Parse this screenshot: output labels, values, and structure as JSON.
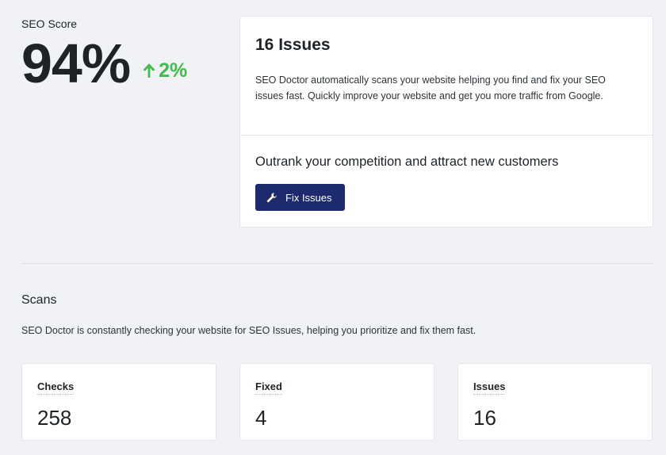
{
  "score": {
    "label": "SEO Score",
    "value": "94%",
    "change": "2%",
    "change_color": "#3ebd4a",
    "change_icon": "arrow-up-icon"
  },
  "issues_card": {
    "title": "16 Issues",
    "description": "SEO Doctor automatically scans your website helping you find and fix your SEO issues fast. Quickly improve your website and get you more traffic from Google.",
    "cta_heading": "Outrank your competition and attract new customers",
    "button_label": "Fix Issues",
    "button_icon": "wrench-icon",
    "button_color": "#1e2a6e"
  },
  "scans": {
    "title": "Scans",
    "description": "SEO Doctor is constantly checking your website for SEO Issues, helping you prioritize and fix them fast.",
    "stats": [
      {
        "label": "Checks",
        "value": "258"
      },
      {
        "label": "Fixed",
        "value": "4"
      },
      {
        "label": "Issues",
        "value": "16"
      }
    ]
  }
}
